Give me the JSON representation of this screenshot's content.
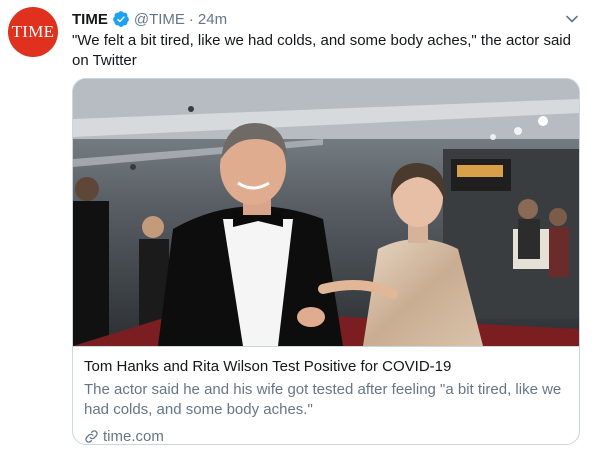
{
  "tweet": {
    "author": {
      "avatar_text": "TIME",
      "name": "TIME",
      "handle": "@TIME",
      "separator": "·",
      "time_ago": "24m",
      "verified_icon": "verified-badge-icon",
      "avatar_color": "#e0301e"
    },
    "text": "\"We felt a bit tired, like we had colds, and some body aches,\" the actor said on Twitter",
    "menu_icon": "chevron-down-icon",
    "card": {
      "image_alt": "Tom Hanks and Rita Wilson on the red carpet",
      "title": "Tom Hanks and Rita Wilson Test Positive for COVID-19",
      "description": "The actor said he and his wife got tested after feeling \"a bit tired, like we had colds, and some body aches.\"",
      "link_icon": "link-icon",
      "domain": "time.com"
    }
  },
  "colors": {
    "primary_text": "#14171a",
    "secondary_text": "#657786",
    "verified_blue": "#1da1f2",
    "border": "#ccd6dd"
  }
}
